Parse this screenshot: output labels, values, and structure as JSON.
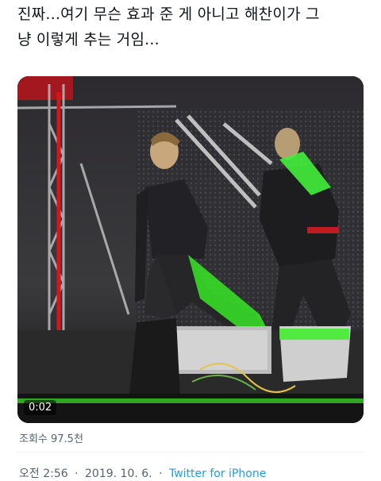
{
  "tweet": {
    "text": "진짜...여기 무슨 효과 준 게 아니고 해찬이가 그\n냥 이렇게 추는 거임...",
    "video": {
      "timestamp": "0:02"
    },
    "views": "조회수 97.5천",
    "time": "오전 2:56",
    "date": "2019. 10. 6.",
    "separator": "·",
    "client": "Twitter for iPhone"
  },
  "colors": {
    "link": "#1d9bf0",
    "secondary_text": "#536471",
    "stage_green": "#39e62a",
    "stage_red": "#d8141c"
  }
}
